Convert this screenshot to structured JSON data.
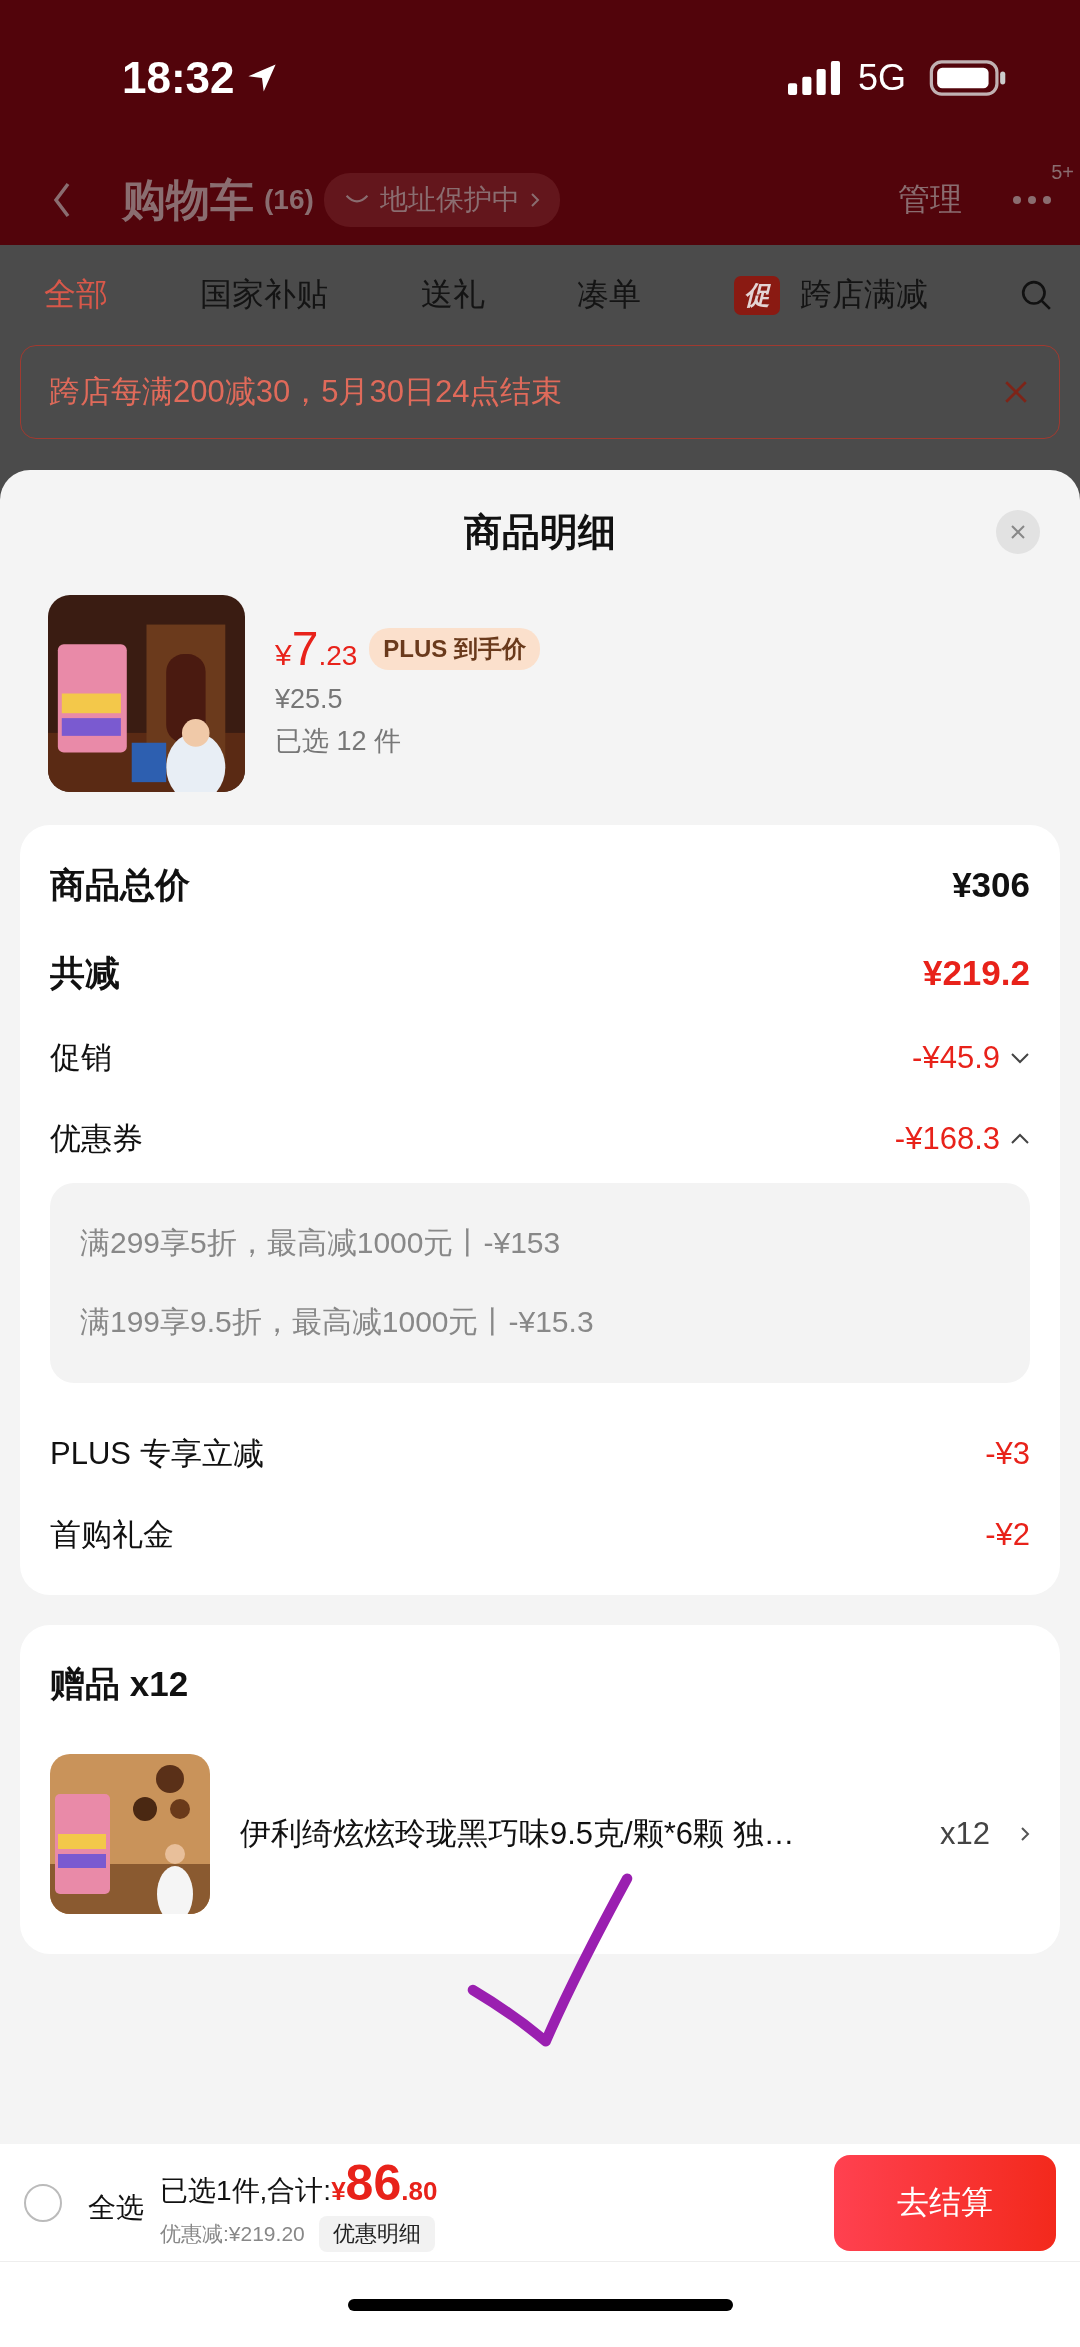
{
  "status_bar": {
    "time": "18:32",
    "network": "5G"
  },
  "nav": {
    "title": "购物车",
    "count": "(16)",
    "address_pill": "地址保护中",
    "manage": "管理",
    "badge": "5+"
  },
  "tabs": [
    {
      "label": "全部",
      "selected": true
    },
    {
      "label": "国家补贴",
      "selected": false
    },
    {
      "label": "送礼",
      "selected": false
    },
    {
      "label": "凑单",
      "selected": false
    },
    {
      "label": "跨店满减",
      "selected": false,
      "tag": "促"
    }
  ],
  "promo_banner": {
    "text": "跨店每满200减30，5月30日24点结束"
  },
  "sheet": {
    "title": "商品明细",
    "product": {
      "currency": "¥",
      "price_int": "7",
      "price_dec": ".23",
      "price_tag": "PLUS 到手价",
      "original_price": "¥25.5",
      "selected_count": "已选 12 件"
    },
    "summary": [
      {
        "kind": "total",
        "label": "商品总价",
        "value": "¥306"
      },
      {
        "kind": "reduction",
        "label": "共减",
        "value": "¥219.2"
      },
      {
        "kind": "expandable",
        "label": "促销",
        "value": "-¥45.9",
        "expanded": false
      },
      {
        "kind": "expandable",
        "label": "优惠券",
        "value": "-¥168.3",
        "expanded": true,
        "details": [
          "满299享5折，最高减1000元丨-¥153",
          "满199享9.5折，最高减1000元丨-¥15.3"
        ]
      },
      {
        "kind": "line",
        "label": "PLUS 专享立减",
        "value": "-¥3"
      },
      {
        "kind": "line",
        "label": "首购礼金",
        "value": "-¥2"
      }
    ],
    "gifts": {
      "title": "赠品 x12",
      "items": [
        {
          "name": "伊利绮炫炫玲珑黑巧味9.5克/颗*6颗 独…",
          "quantity": "x12"
        }
      ]
    }
  },
  "bottom_bar": {
    "select_all_checked": false,
    "select_all": "全选",
    "summary_prefix": "已选1件,合计:",
    "currency": "¥",
    "total_int": "86",
    "total_dec": ".80",
    "discount": "优惠减:¥219.20",
    "detail_button": "优惠明细",
    "checkout": "去结算"
  }
}
